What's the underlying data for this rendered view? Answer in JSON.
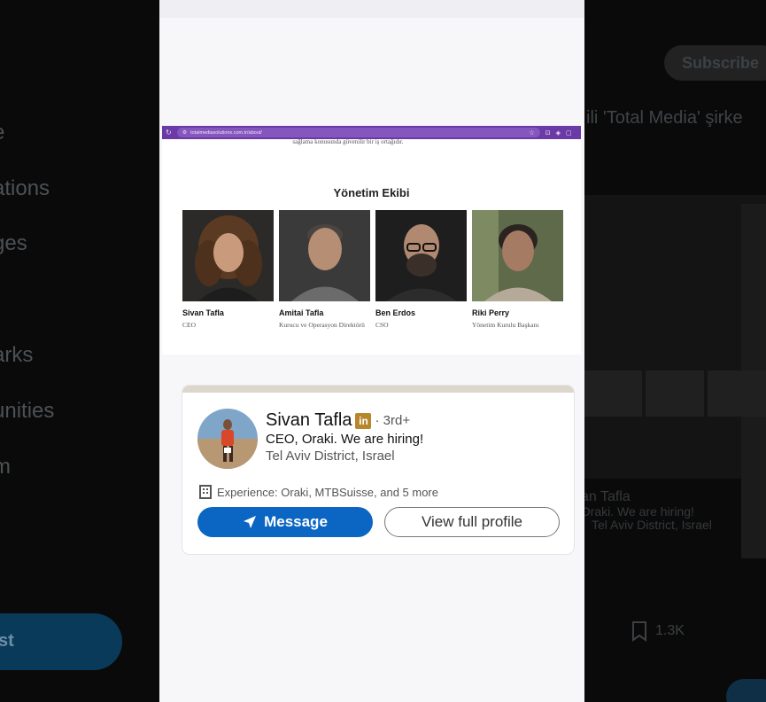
{
  "background": {
    "nav_items": [
      "e",
      "ations",
      "ges",
      "arks",
      "unities",
      "m"
    ],
    "post_label": "st",
    "subscribe_label": "Subscribe",
    "tweet_text": "ili 'Total Media' şirke",
    "bookmark_count": "1.3K",
    "card_echo": {
      "name": "van Tafla",
      "headline": ", Oraki. We are hiring!",
      "location": "Tel Aviv District, Israel"
    }
  },
  "website": {
    "url": "totalmediasolutions.com.tr/about/",
    "partial_text": "sağlama konusunda güvenilir bir iş ortağıdır.",
    "section_title": "Yönetim Ekibi",
    "team": [
      {
        "name": "Sivan Tafla",
        "role": "CEO"
      },
      {
        "name": "Amitai Tafla",
        "role": "Kurucu ve Operasyon Direktörü"
      },
      {
        "name": "Ben Erdos",
        "role": "CSO"
      },
      {
        "name": "Riki Perry",
        "role": "Yönetim Kurulu Başkanı"
      }
    ]
  },
  "profile_card": {
    "name": "Sivan Tafla",
    "badge": "in",
    "degree": "· 3rd+",
    "headline": "CEO, Oraki. We are hiring!",
    "location": "Tel Aviv District, Israel",
    "experience": "Experience: Oraki, MTBSuisse, and 5 more",
    "message_label": "Message",
    "view_profile_label": "View full profile"
  },
  "colors": {
    "linkedin_blue": "#0a66c2",
    "browser_purple": "#6b3aa6",
    "linkedin_gold": "#b8862b"
  },
  "icons": [
    "building-icon",
    "send-icon",
    "bookmark-icon",
    "star-icon",
    "reload-icon",
    "tune-icon"
  ]
}
